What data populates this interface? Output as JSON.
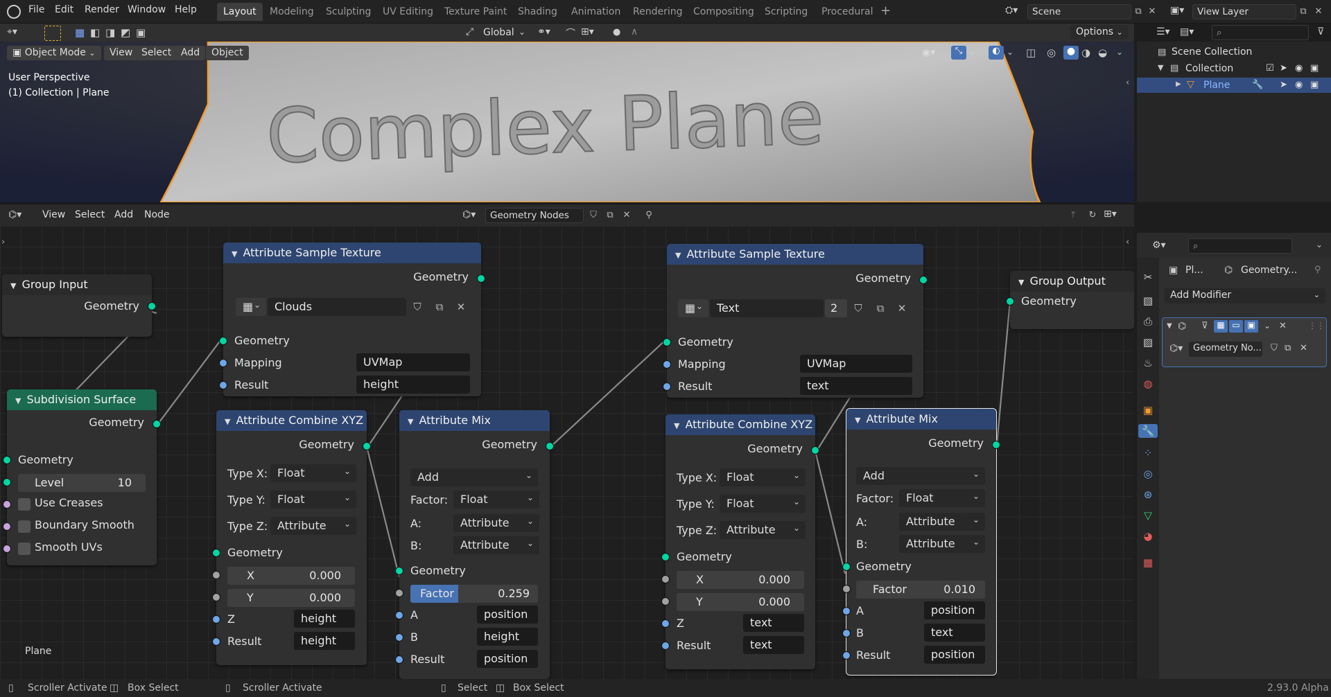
{
  "topbar": {
    "menus": [
      "File",
      "Edit",
      "Render",
      "Window",
      "Help"
    ],
    "workspaces": [
      "Layout",
      "Modeling",
      "Sculpting",
      "UV Editing",
      "Texture Paint",
      "Shading",
      "Animation",
      "Rendering",
      "Compositing",
      "Scripting",
      "Procedural"
    ],
    "active_workspace": "Layout",
    "scene": "Scene",
    "view_layer": "View Layer"
  },
  "viewport": {
    "transform_orientation": "Global",
    "options_label": "Options",
    "mode": "Object Mode",
    "menus": [
      "View",
      "Select",
      "Add",
      "Object"
    ],
    "overlay_line1": "User Perspective",
    "overlay_line2": "(1) Collection | Plane",
    "mesh_text": "Complex Plane"
  },
  "node_editor": {
    "menus": [
      "View",
      "Select",
      "Add",
      "Node"
    ],
    "tree_name": "Geometry Nodes",
    "object_label": "Plane"
  },
  "nodes": {
    "group_input": {
      "title": "Group Input",
      "out_geometry": "Geometry"
    },
    "subdiv": {
      "title": "Subdivision Surface",
      "out_geometry": "Geometry",
      "in_geometry": "Geometry",
      "level_label": "Level",
      "level_value": "10",
      "use_creases": "Use Creases",
      "boundary_smooth": "Boundary Smooth",
      "smooth_uvs": "Smooth UVs"
    },
    "ast1": {
      "title": "Attribute Sample Texture",
      "out_geometry": "Geometry",
      "texture": "Clouds",
      "in_geometry": "Geometry",
      "mapping_label": "Mapping",
      "mapping_value": "UVMap",
      "result_label": "Result",
      "result_value": "height"
    },
    "acx1": {
      "title": "Attribute Combine XYZ",
      "out_geometry": "Geometry",
      "type_x_label": "Type X:",
      "type_x": "Float",
      "type_y_label": "Type Y:",
      "type_y": "Float",
      "type_z_label": "Type Z:",
      "type_z": "Attribute",
      "in_geometry": "Geometry",
      "x_label": "X",
      "x_value": "0.000",
      "y_label": "Y",
      "y_value": "0.000",
      "z_label": "Z",
      "z_value": "height",
      "result_label": "Result",
      "result_value": "height"
    },
    "amix1": {
      "title": "Attribute Mix",
      "out_geometry": "Geometry",
      "blend": "Add",
      "factor_label": "Factor:",
      "factor_type": "Float",
      "a_label": "A:",
      "a_type": "Attribute",
      "b_label": "B:",
      "b_type": "Attribute",
      "in_geometry": "Geometry",
      "factor_name": "Factor",
      "factor_value": "0.259",
      "factor_fill": 0.259,
      "a_name": "A",
      "a_value": "position",
      "b_name": "B",
      "b_value": "height",
      "result_name": "Result",
      "result_value": "position"
    },
    "ast2": {
      "title": "Attribute Sample Texture",
      "out_geometry": "Geometry",
      "texture": "Text",
      "users": "2",
      "in_geometry": "Geometry",
      "mapping_label": "Mapping",
      "mapping_value": "UVMap",
      "result_label": "Result",
      "result_value": "text"
    },
    "acx2": {
      "title": "Attribute Combine XYZ",
      "out_geometry": "Geometry",
      "type_x_label": "Type X:",
      "type_x": "Float",
      "type_y_label": "Type Y:",
      "type_y": "Float",
      "type_z_label": "Type Z:",
      "type_z": "Attribute",
      "in_geometry": "Geometry",
      "x_label": "X",
      "x_value": "0.000",
      "y_label": "Y",
      "y_value": "0.000",
      "z_label": "Z",
      "z_value": "text",
      "result_label": "Result",
      "result_value": "text"
    },
    "amix2": {
      "title": "Attribute Mix",
      "out_geometry": "Geometry",
      "blend": "Add",
      "factor_label": "Factor:",
      "factor_type": "Float",
      "a_label": "A:",
      "a_type": "Attribute",
      "b_label": "B:",
      "b_type": "Attribute",
      "in_geometry": "Geometry",
      "factor_name": "Factor",
      "factor_value": "0.010",
      "a_name": "A",
      "a_value": "position",
      "b_name": "B",
      "b_value": "text",
      "result_name": "Result",
      "result_value": "position"
    },
    "group_output": {
      "title": "Group Output",
      "in_geometry": "Geometry"
    }
  },
  "outliner": {
    "scene_collection": "Scene Collection",
    "collection": "Collection",
    "object": "Plane"
  },
  "properties": {
    "object_short": "Pl...",
    "modifier_tree": "Geometry...",
    "add_modifier": "Add Modifier",
    "modifier_name": "Geometry No..."
  },
  "statusbar": {
    "items": [
      "Scroller Activate",
      "Box Select",
      "Scroller Activate",
      "Select",
      "Box Select"
    ],
    "version": "2.93.0 Alpha"
  },
  "colors": {
    "geometry_socket": "#00d6a3",
    "attribute_socket": "#6ea6e6",
    "node_header_blue": "#2d4570",
    "node_header_green": "#1b6b50",
    "selection_orange": "#f09a30"
  }
}
